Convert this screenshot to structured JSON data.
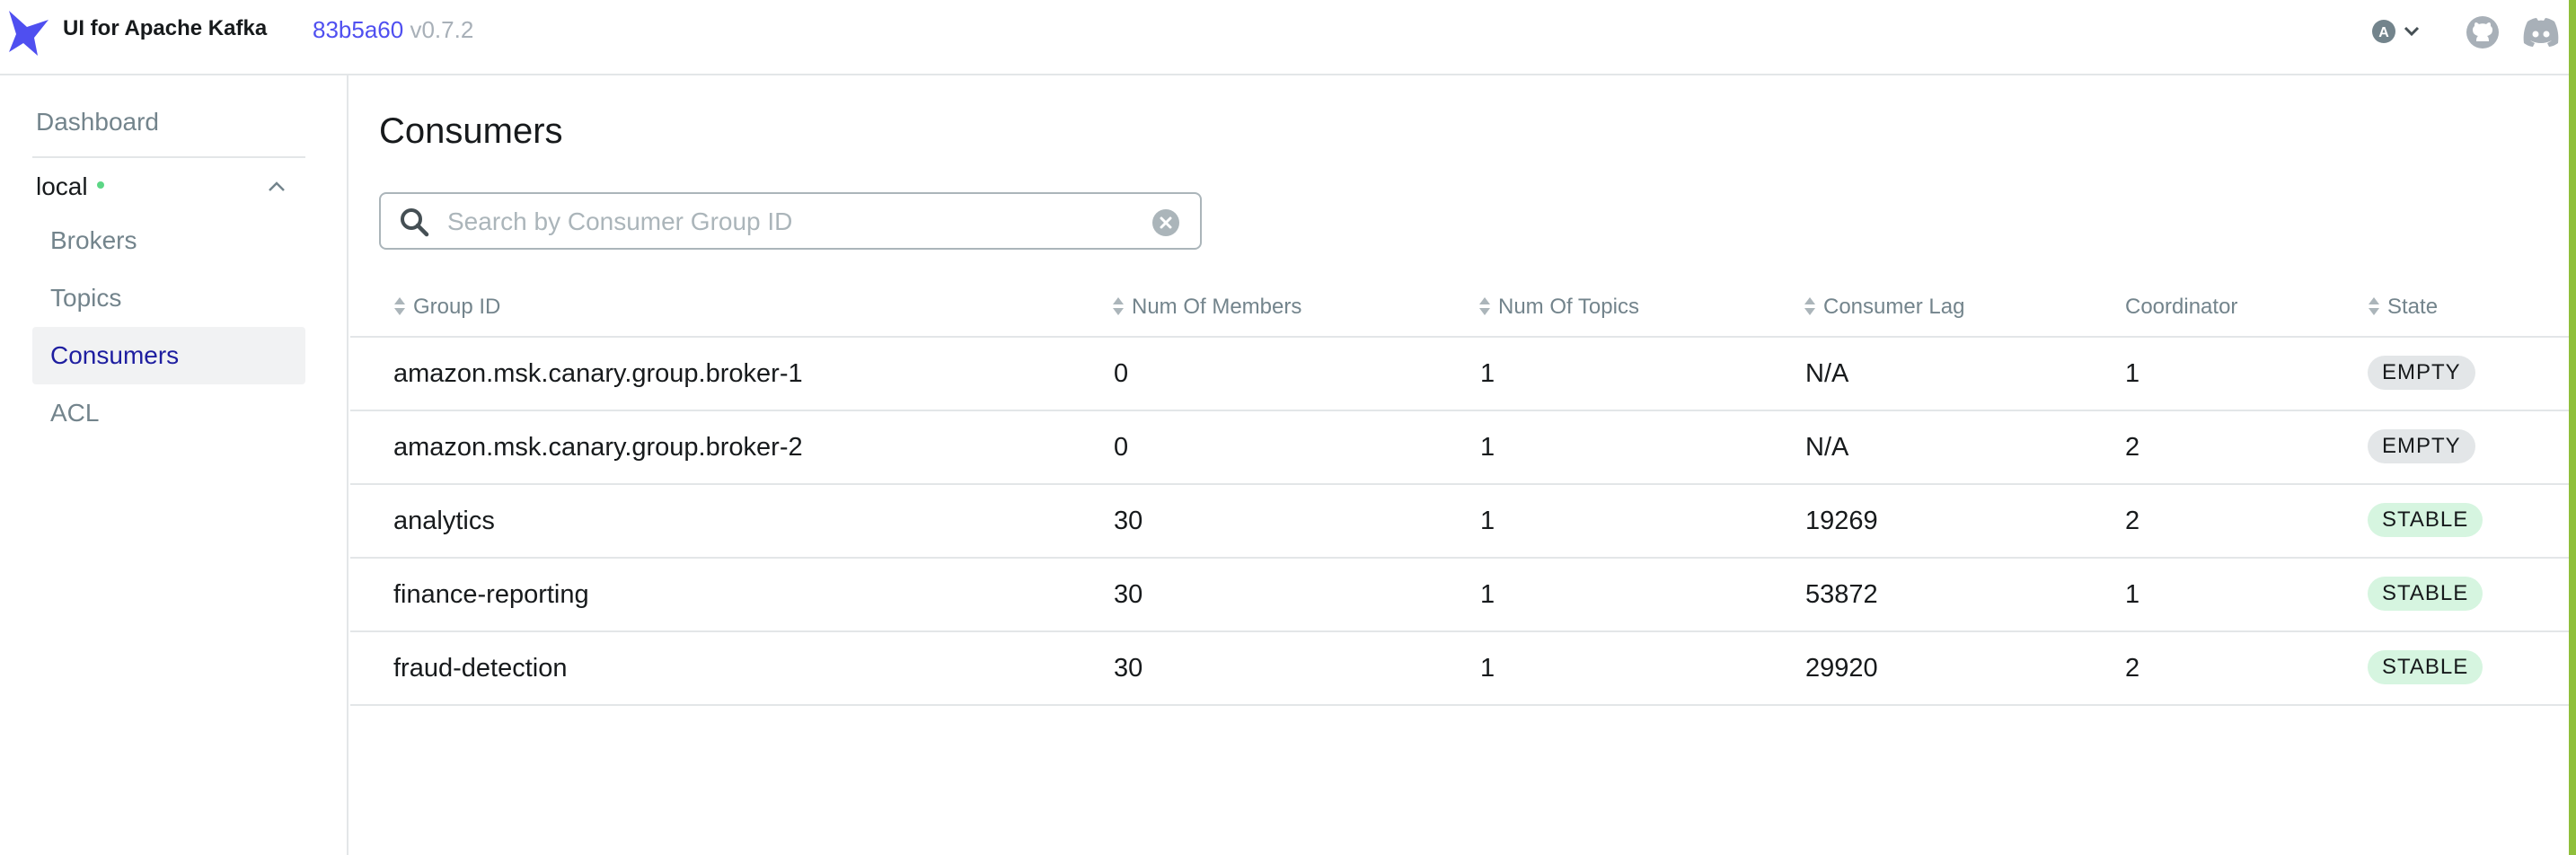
{
  "header": {
    "app_title": "UI for Apache Kafka",
    "commit": "83b5a60",
    "version": "v0.7.2",
    "user_avatar_letter": "A"
  },
  "sidebar": {
    "dashboard": "Dashboard",
    "cluster_name": "local",
    "cluster_status_color": "#5cd685",
    "items": [
      {
        "label": "Brokers",
        "active": false
      },
      {
        "label": "Topics",
        "active": false
      },
      {
        "label": "Consumers",
        "active": true
      },
      {
        "label": "ACL",
        "active": false
      }
    ]
  },
  "main": {
    "title": "Consumers",
    "search": {
      "placeholder": "Search by Consumer Group ID",
      "value": ""
    },
    "table": {
      "columns": [
        "Group ID",
        "Num Of Members",
        "Num Of Topics",
        "Consumer Lag",
        "Coordinator",
        "State"
      ],
      "rows": [
        {
          "group_id": "amazon.msk.canary.group.broker-1",
          "members": "0",
          "topics": "1",
          "lag": "N/A",
          "coordinator": "1",
          "state": "EMPTY"
        },
        {
          "group_id": "amazon.msk.canary.group.broker-2",
          "members": "0",
          "topics": "1",
          "lag": "N/A",
          "coordinator": "2",
          "state": "EMPTY"
        },
        {
          "group_id": "analytics",
          "members": "30",
          "topics": "1",
          "lag": "19269",
          "coordinator": "2",
          "state": "STABLE"
        },
        {
          "group_id": "finance-reporting",
          "members": "30",
          "topics": "1",
          "lag": "53872",
          "coordinator": "1",
          "state": "STABLE"
        },
        {
          "group_id": "fraud-detection",
          "members": "30",
          "topics": "1",
          "lag": "29920",
          "coordinator": "2",
          "state": "STABLE"
        }
      ]
    }
  },
  "colors": {
    "accent": "#4f4ff0",
    "active_nav_text": "#1e1ea0",
    "badge_empty": "#e3e6e8",
    "badge_stable": "#d6f5e0"
  }
}
